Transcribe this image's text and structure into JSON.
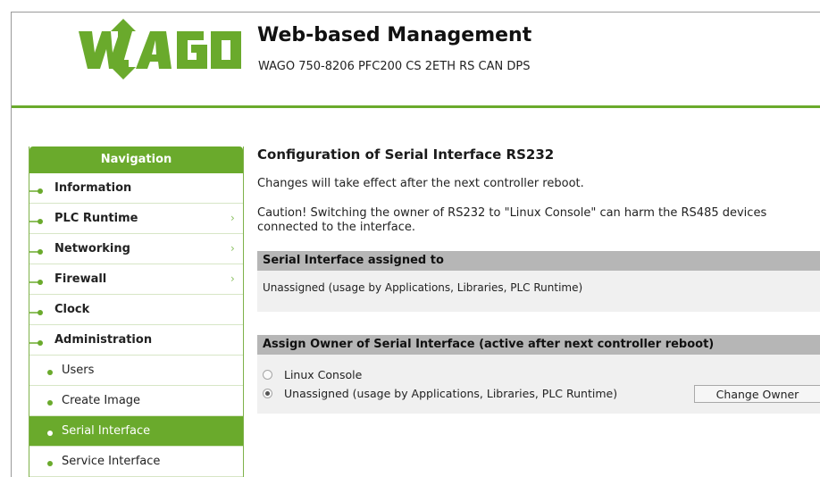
{
  "header": {
    "logo_text": "WAGO",
    "title": "Web-based Management",
    "device": "WAGO 750-8206 PFC200 CS 2ETH RS CAN DPS"
  },
  "colors": {
    "brand_green": "#6aaa2c",
    "panel_header": "#b6b6b6",
    "panel_body": "#f0f0f0"
  },
  "navigation": {
    "title": "Navigation",
    "items": [
      {
        "label": "Information",
        "has_submenu": false
      },
      {
        "label": "PLC Runtime",
        "has_submenu": true,
        "icon": "chevron-right-icon"
      },
      {
        "label": "Networking",
        "has_submenu": true,
        "icon": "chevron-right-icon"
      },
      {
        "label": "Firewall",
        "has_submenu": true,
        "icon": "chevron-right-icon"
      },
      {
        "label": "Clock",
        "has_submenu": false
      },
      {
        "label": "Administration",
        "has_submenu": false,
        "expanded": true
      }
    ],
    "subitems": [
      {
        "label": "Users",
        "active": false
      },
      {
        "label": "Create Image",
        "active": false
      },
      {
        "label": "Serial Interface",
        "active": true
      },
      {
        "label": "Service Interface",
        "active": false
      }
    ]
  },
  "content": {
    "title": "Configuration of Serial Interface RS232",
    "info": "Changes will take effect after the next controller reboot.",
    "caution": "Caution! Switching the owner of RS232 to \"Linux Console\" can harm the RS485 devices connected to the interface.",
    "assigned_panel": {
      "title": "Serial Interface assigned to",
      "value": "Unassigned (usage by Applications, Libraries, PLC Runtime)"
    },
    "owner_panel": {
      "title": "Assign Owner of Serial Interface (active after next controller reboot)",
      "options": [
        {
          "label": "Linux Console",
          "checked": false
        },
        {
          "label": "Unassigned (usage by Applications, Libraries, PLC Runtime)",
          "checked": true
        }
      ],
      "button_label": "Change Owner"
    }
  }
}
